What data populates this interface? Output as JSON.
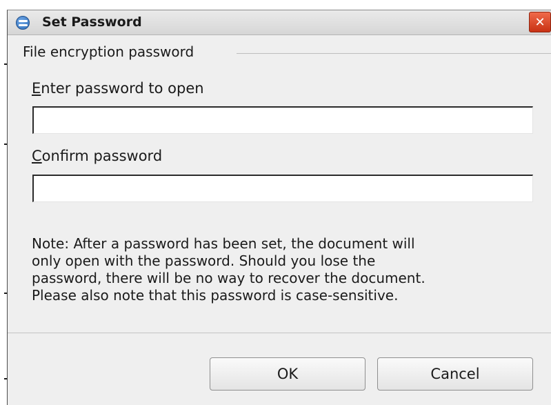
{
  "window": {
    "title": "Set Password",
    "close_symbol": "✕",
    "icon": "app-globe-icon"
  },
  "encryption": {
    "section_label": "File encryption password",
    "enter_label_mnemonic": "E",
    "enter_label_rest": "nter password to open",
    "enter_value": "",
    "confirm_label_mnemonic": "C",
    "confirm_label_rest": "onfirm password",
    "confirm_value": ""
  },
  "note": "Note: After a password has been set, the document will\nonly open with the password. Should you lose the\npassword, there will be no way to recover the document.\nPlease also note that this password is case-sensitive.",
  "buttons": {
    "ok": "OK",
    "cancel": "Cancel"
  },
  "colors": {
    "dialog_bg": "#efefef",
    "close_button": "#d9441f",
    "text": "#1a1a1a"
  }
}
